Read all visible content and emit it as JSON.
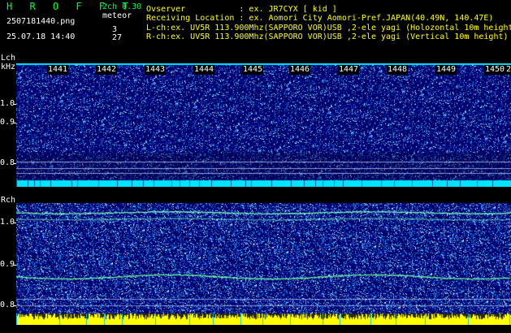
{
  "header": {
    "app_title": "H R O F F T",
    "version": "2ch 0.30",
    "mode": "meteor",
    "filename": "2507181440.png",
    "datetime": "25.07.18 14:40",
    "count_l": "3",
    "count_r": "27"
  },
  "info": {
    "observer": "Ovserver           : ex. JR7CYX [ kid ]",
    "location": "Receiving Location : ex. Aomori City Aomori-Pref.JAPAN(40.49N, 140.47E)",
    "lch": "L-ch:ex. UV5R 113.900Mhz(SAPPORO VOR)USB ,2-ele yagi (Holozontal 10m height",
    "rch": "R-ch:ex. UV5R 113.900Mhz(SAPPORO VOR)USB ,2-ele yagi (Vertical 10m height)"
  },
  "lch": {
    "label": "Lch",
    "unit": "kHz",
    "ticks": [
      "1.0",
      "0.9",
      "0.8"
    ]
  },
  "rch": {
    "label": "Rch",
    "ticks": [
      "1.0",
      "0.9",
      "0.8"
    ]
  },
  "time_labels": [
    "1441",
    "1442",
    "1443",
    "1444",
    "1445",
    "1446",
    "1447",
    "1448",
    "1449",
    "1450",
    "2"
  ],
  "colors": {
    "text_green": "#00ff3c",
    "text_white": "#ffffff",
    "noise_bg": "#00007a",
    "cyan_band": "#00e5ff",
    "yellow_band": "#ffff00"
  }
}
